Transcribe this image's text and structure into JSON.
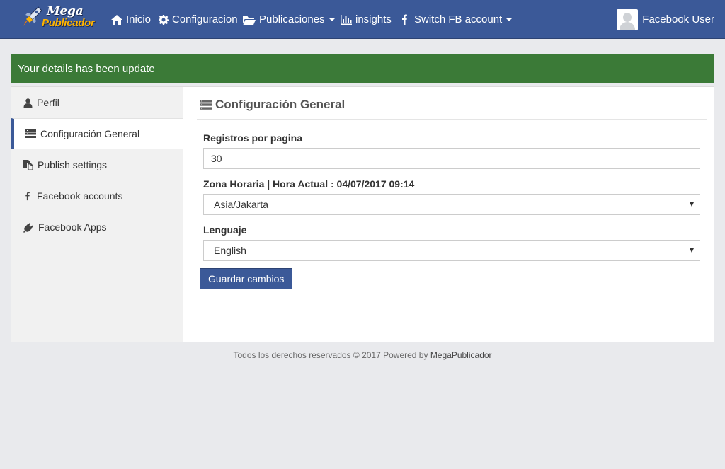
{
  "brand": {
    "line1": "Mega",
    "line2": "Publicador"
  },
  "nav": {
    "items": [
      {
        "label": "Inicio",
        "icon": "home-icon"
      },
      {
        "label": "Configuracion",
        "icon": "gear-icon"
      },
      {
        "label": "Publicaciones",
        "icon": "folder-open-icon"
      },
      {
        "label": "insights",
        "icon": "bar-chart-icon"
      },
      {
        "label": "Switch FB account",
        "icon": "facebook-icon"
      }
    ],
    "user_name": "Facebook User"
  },
  "alert": {
    "message": "Your details has been update",
    "color": "#3b7a37"
  },
  "sidebar": {
    "items": [
      {
        "label": "Perfil",
        "icon": "user-icon"
      },
      {
        "label": "Configuración General",
        "icon": "list-icon",
        "active": true
      },
      {
        "label": "Publish settings",
        "icon": "copy-icon"
      },
      {
        "label": "Facebook accounts",
        "icon": "facebook-icon"
      },
      {
        "label": "Facebook Apps",
        "icon": "plug-icon"
      }
    ]
  },
  "content": {
    "title": "Configuración General",
    "records_label": "Registros por pagina",
    "records_value": "30",
    "timezone_label": "Zona Horaria | Hora Actual : 04/07/2017 09:14",
    "timezone_value": "Asia/Jakarta",
    "language_label": "Lenguaje",
    "language_value": "English",
    "save_label": "Guardar cambios"
  },
  "footer": {
    "text": "Todos los derechos reservados © 2017 Powered by",
    "brand": "MegaPublicador"
  },
  "colors": {
    "navbar": "#3b5998",
    "accent": "#3b5998",
    "background": "#e9eaed"
  }
}
